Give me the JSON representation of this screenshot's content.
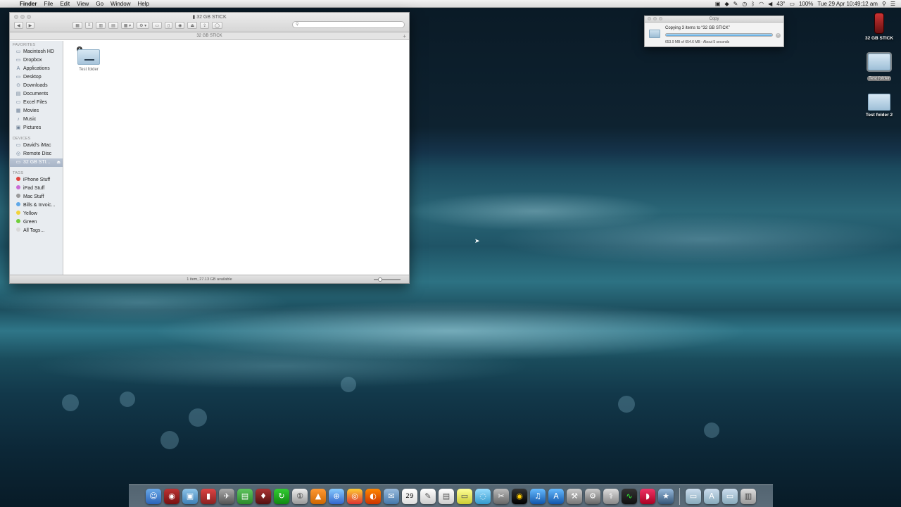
{
  "menubar": {
    "app_name": "Finder",
    "menus": [
      "File",
      "Edit",
      "View",
      "Go",
      "Window",
      "Help"
    ],
    "battery": "100%",
    "temperature": "43°",
    "clock": "Tue 29 Apr  10:49:12 am"
  },
  "finder": {
    "title": "32 GB STICK",
    "path_title": "32 GB STICK",
    "search_placeholder": "",
    "sidebar": {
      "favorites_header": "FAVORITES",
      "favorites": [
        "Macintosh HD",
        "Dropbox",
        "Applications",
        "Desktop",
        "Downloads",
        "Documents",
        "Excel Files",
        "Movies",
        "Music",
        "Pictures"
      ],
      "devices_header": "DEVICES",
      "devices": [
        "David's iMac",
        "Remote Disc",
        "32 GB STI..."
      ],
      "tags_header": "TAGS",
      "tags": [
        {
          "label": "iPhone Stuff",
          "color": "#e0443e"
        },
        {
          "label": "iPad Stuff",
          "color": "#c96ad6"
        },
        {
          "label": "Mac Stuff",
          "color": "#9a9a9a"
        },
        {
          "label": "Bills & Invoic...",
          "color": "#5fa8e8"
        },
        {
          "label": "Yellow",
          "color": "#f2d33a"
        },
        {
          "label": "Green",
          "color": "#6fcf3a"
        },
        {
          "label": "All Tags...",
          "color": "#d8d8d8"
        }
      ]
    },
    "files": [
      {
        "name": "Test folder"
      }
    ],
    "status": "1 item, 27.13 GB available"
  },
  "copy_dialog": {
    "title": "Copy",
    "message": "Copying 3 items to “32 GB STICK”",
    "progress": 0.998,
    "detail": "653.9 MB of 654.6 MB - About 5 seconds"
  },
  "desktop": {
    "icons": [
      {
        "label": "32 GB STICK"
      },
      {
        "label": "Test folder"
      },
      {
        "label": "Test folder 2"
      }
    ]
  },
  "dock": {
    "calendar_day": "29",
    "icons": [
      "finder-icon",
      "photo-booth-icon",
      "preview-icon",
      "books-icon",
      "launchpad-icon",
      "numbers-icon",
      "instruments-icon",
      "sync-icon",
      "1password-icon",
      "vlc-icon",
      "safari-icon",
      "chrome-icon",
      "firefox-icon",
      "mail-icon",
      "calendar-icon",
      "textedit-icon",
      "notes-icon",
      "stickies-icon",
      "messages-icon",
      "utility-icon",
      "terminal-icon",
      "itunes-icon",
      "app-store-icon",
      "xcode-icon",
      "system-preferences-icon",
      "disk-utility-icon",
      "activity-monitor-icon",
      "lips-app-icon",
      "imovie-icon"
    ]
  }
}
